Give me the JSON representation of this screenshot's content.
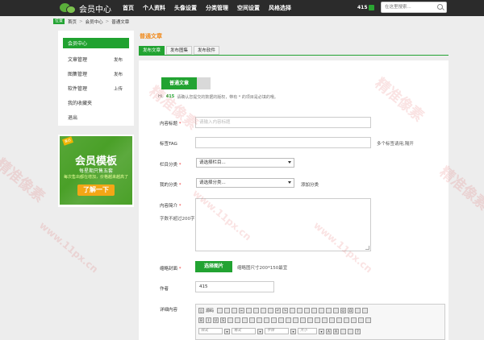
{
  "topbar": {
    "logo_text": "会员中心",
    "nav": [
      "首页",
      "个人资料",
      "头像设置",
      "分类管理",
      "空间设置",
      "风格选择"
    ],
    "user_number": "415",
    "search_placeholder": "在这里搜索..."
  },
  "breadcrumb": {
    "tag": "位置",
    "items": [
      "首页",
      "会员中心",
      "普通文章"
    ],
    "separator": ">"
  },
  "sidebar": {
    "items": [
      {
        "label": "会员中心",
        "action": "",
        "active": true
      },
      {
        "label": "文章管理",
        "action": "发布",
        "active": false
      },
      {
        "label": "图集管理",
        "action": "发布",
        "active": false
      },
      {
        "label": "软件管理",
        "action": "上传",
        "active": false
      },
      {
        "label": "我的收藏夹",
        "action": "",
        "active": false
      },
      {
        "label": "退出",
        "action": "",
        "active": false
      }
    ]
  },
  "banner": {
    "tag": "黑白",
    "title": "会员模板",
    "subtitle": "每星期只售五套",
    "line": "每次售出都在增加，价格越来越高了",
    "button": "了解一下"
  },
  "main": {
    "title": "普通文章",
    "tabs": [
      "发布文章",
      "发布图集",
      "发布软件"
    ],
    "segment": "普通文章",
    "hint_prefix": "Hi,",
    "hint_user": "415",
    "hint_text": "请确认您提交的数据的版权，带有 * 的项目是必填的哦。",
    "form": {
      "title_label": "内容标题",
      "title_placeholder": "请输入内容标题",
      "tag_label": "标签TAG",
      "tag_note": "多个标签请用,隔开",
      "column_label": "栏目分类",
      "column_value": "请选择栏目...",
      "my_cat_label": "我的分类",
      "my_cat_value": "请选择分类...",
      "add_cat": "添加分类",
      "summary_label": "内容简介",
      "summary_note": "字数不超过200字",
      "cover_label": "缩略封面",
      "cover_button": "选择图片",
      "cover_note": "缩略图尺寸200*150最宜",
      "author_label": "作者",
      "author_value": "415",
      "detail_label": "详细内容"
    },
    "editor": {
      "source_label": "源码",
      "style_label": "样式",
      "format_label": "格式",
      "font_label": "字体",
      "size_label": "大小"
    }
  },
  "colors": {
    "accent_green": "#22a332",
    "title_orange": "#f08a1c",
    "topbar": "#2b2b2b"
  }
}
